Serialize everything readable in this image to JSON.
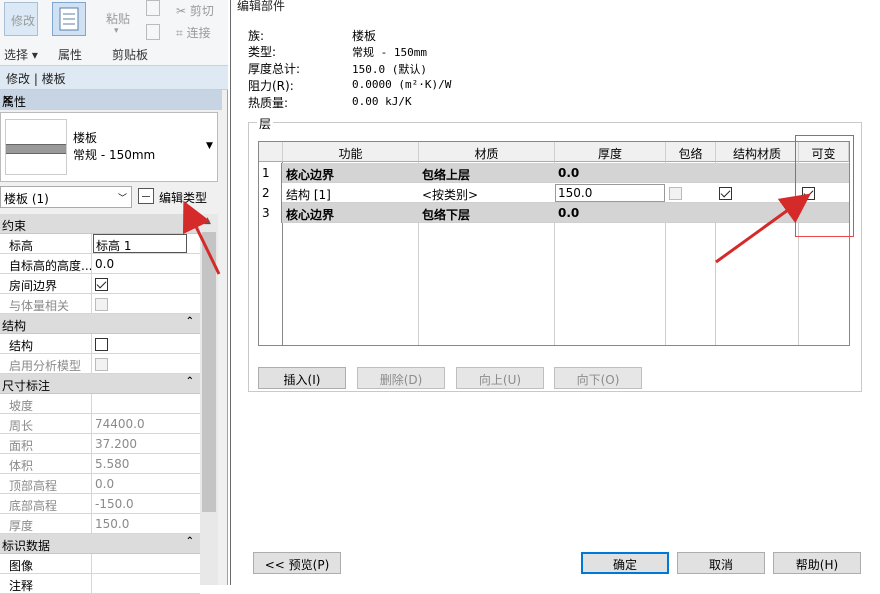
{
  "ribbon": {
    "modify_label": "修改",
    "select_label": "选择",
    "properties_label": "属性",
    "paste_label": "粘贴",
    "clipboard_label": "剪贴板",
    "cut_label": "剪切",
    "join_label": "连接"
  },
  "context_bar": "修改 | 楼板",
  "properties": {
    "title": "属性",
    "type_name": "楼板",
    "type_sub": "常规 - 150mm",
    "instance_selector": "楼板 (1)",
    "edit_type_label": "编辑类型",
    "groups": [
      {
        "name": "约束",
        "rows": [
          {
            "key": "标高",
            "value": "标高 1",
            "editing": true
          },
          {
            "key": "自标高的高度...",
            "value": "0.0"
          },
          {
            "key": "房间边界",
            "checkbox": true,
            "checked": true
          },
          {
            "key": "与体量相关",
            "checkbox": true,
            "checked": false,
            "disabled": true
          }
        ]
      },
      {
        "name": "结构",
        "rows": [
          {
            "key": "结构",
            "checkbox": true,
            "checked": false
          },
          {
            "key": "启用分析模型",
            "checkbox": true,
            "checked": false,
            "disabled": true
          }
        ]
      },
      {
        "name": "尺寸标注",
        "rows": [
          {
            "key": "坡度",
            "value": "",
            "disabled": true
          },
          {
            "key": "周长",
            "value": "74400.0",
            "disabled": true
          },
          {
            "key": "面积",
            "value": "37.200",
            "disabled": true
          },
          {
            "key": "体积",
            "value": "5.580",
            "disabled": true
          },
          {
            "key": "顶部高程",
            "value": "0.0",
            "disabled": true
          },
          {
            "key": "底部高程",
            "value": "-150.0",
            "disabled": true
          },
          {
            "key": "厚度",
            "value": "150.0",
            "disabled": true
          }
        ]
      },
      {
        "name": "标识数据",
        "rows": [
          {
            "key": "图像",
            "value": ""
          },
          {
            "key": "注释",
            "value": ""
          }
        ]
      }
    ]
  },
  "dialog": {
    "title": "编辑部件",
    "info": {
      "family_label": "族:",
      "family_value": "楼板",
      "type_label": "类型:",
      "type_value": "常规 - 150mm",
      "thickness_label": "厚度总计:",
      "thickness_value": "150.0 (默认)",
      "resistance_label": "阻力(R):",
      "resistance_value": "0.0000 (m²·K)/W",
      "mass_label": "热质量:",
      "mass_value": "0.00 kJ/K"
    },
    "layers_label": "层",
    "columns": [
      "功能",
      "材质",
      "厚度",
      "包络",
      "结构材质",
      "可变"
    ],
    "rows": [
      {
        "num": "1",
        "function": "核心边界",
        "material": "包络上层",
        "thickness": "0.0",
        "core": true
      },
      {
        "num": "2",
        "function": "结构 [1]",
        "material": "<按类别>",
        "thickness": "150.0",
        "core": false,
        "wrap": false,
        "structural": true,
        "variable": true
      },
      {
        "num": "3",
        "function": "核心边界",
        "material": "包络下层",
        "thickness": "0.0",
        "core": true
      }
    ],
    "buttons": {
      "insert": "插入(I)",
      "delete": "删除(D)",
      "up": "向上(U)",
      "down": "向下(O)",
      "preview": "<< 预览(P)",
      "ok": "确定",
      "cancel": "取消",
      "help": "帮助(H)"
    }
  },
  "colors": {
    "annotation": "#e84a4a",
    "arrow": "#d42a2a"
  }
}
